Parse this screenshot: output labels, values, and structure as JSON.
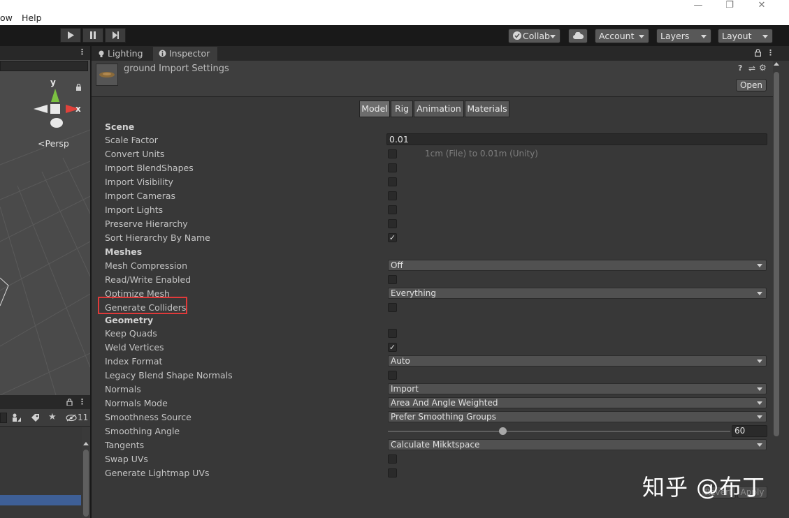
{
  "menubar": {
    "items": [
      "ow",
      "Help"
    ],
    "window_controls": [
      "—",
      "❐",
      "✕"
    ]
  },
  "toolbar": {
    "collab_label": "Collab",
    "account_label": "Account",
    "layers_label": "Layers",
    "layout_label": "Layout"
  },
  "scene": {
    "axis_y": "y",
    "axis_x": "x",
    "projection_label": "Persp"
  },
  "hierarchy": {
    "hidden_count": "11"
  },
  "inspector": {
    "tabs": [
      "Lighting",
      "Inspector"
    ],
    "title": "ground Import Settings",
    "open_label": "Open",
    "mode_tabs": [
      "Model",
      "Rig",
      "Animation",
      "Materials"
    ],
    "active_mode": "Model",
    "sections": {
      "scene": "Scene",
      "meshes": "Meshes",
      "geometry": "Geometry"
    },
    "fields": {
      "scale_factor_label": "Scale Factor",
      "scale_factor_value": "0.01",
      "convert_units_label": "Convert Units",
      "convert_units_note": "1cm (File) to 0.01m (Unity)",
      "import_blendshapes_label": "Import BlendShapes",
      "import_visibility_label": "Import Visibility",
      "import_cameras_label": "Import Cameras",
      "import_lights_label": "Import Lights",
      "preserve_hierarchy_label": "Preserve Hierarchy",
      "sort_hierarchy_label": "Sort Hierarchy By Name",
      "mesh_compression_label": "Mesh Compression",
      "mesh_compression_value": "Off",
      "read_write_label": "Read/Write Enabled",
      "optimize_mesh_label": "Optimize Mesh",
      "optimize_mesh_value": "Everything",
      "generate_colliders_label": "Generate Colliders",
      "keep_quads_label": "Keep Quads",
      "weld_vertices_label": "Weld Vertices",
      "index_format_label": "Index Format",
      "index_format_value": "Auto",
      "legacy_blend_label": "Legacy Blend Shape Normals",
      "normals_label": "Normals",
      "normals_value": "Import",
      "normals_mode_label": "Normals Mode",
      "normals_mode_value": "Area And Angle Weighted",
      "smoothness_source_label": "Smoothness Source",
      "smoothness_source_value": "Prefer Smoothing Groups",
      "smoothing_angle_label": "Smoothing Angle",
      "smoothing_angle_value": "60",
      "tangents_label": "Tangents",
      "tangents_value": "Calculate Mikktspace",
      "swap_uvs_label": "Swap UVs",
      "generate_lightmap_label": "Generate Lightmap UVs"
    },
    "checkboxes": {
      "convert_units": false,
      "import_blendshapes": false,
      "import_visibility": false,
      "import_cameras": false,
      "import_lights": false,
      "preserve_hierarchy": false,
      "sort_hierarchy": true,
      "read_write": false,
      "generate_colliders": false,
      "keep_quads": false,
      "weld_vertices": true,
      "legacy_blend": false,
      "swap_uvs": false,
      "generate_lightmap": false
    },
    "check_glyph": "✓",
    "revert_label": "Revert",
    "apply_label": "Apply",
    "highlight_color": "#e03a3a"
  },
  "watermark": "知乎 @布丁"
}
